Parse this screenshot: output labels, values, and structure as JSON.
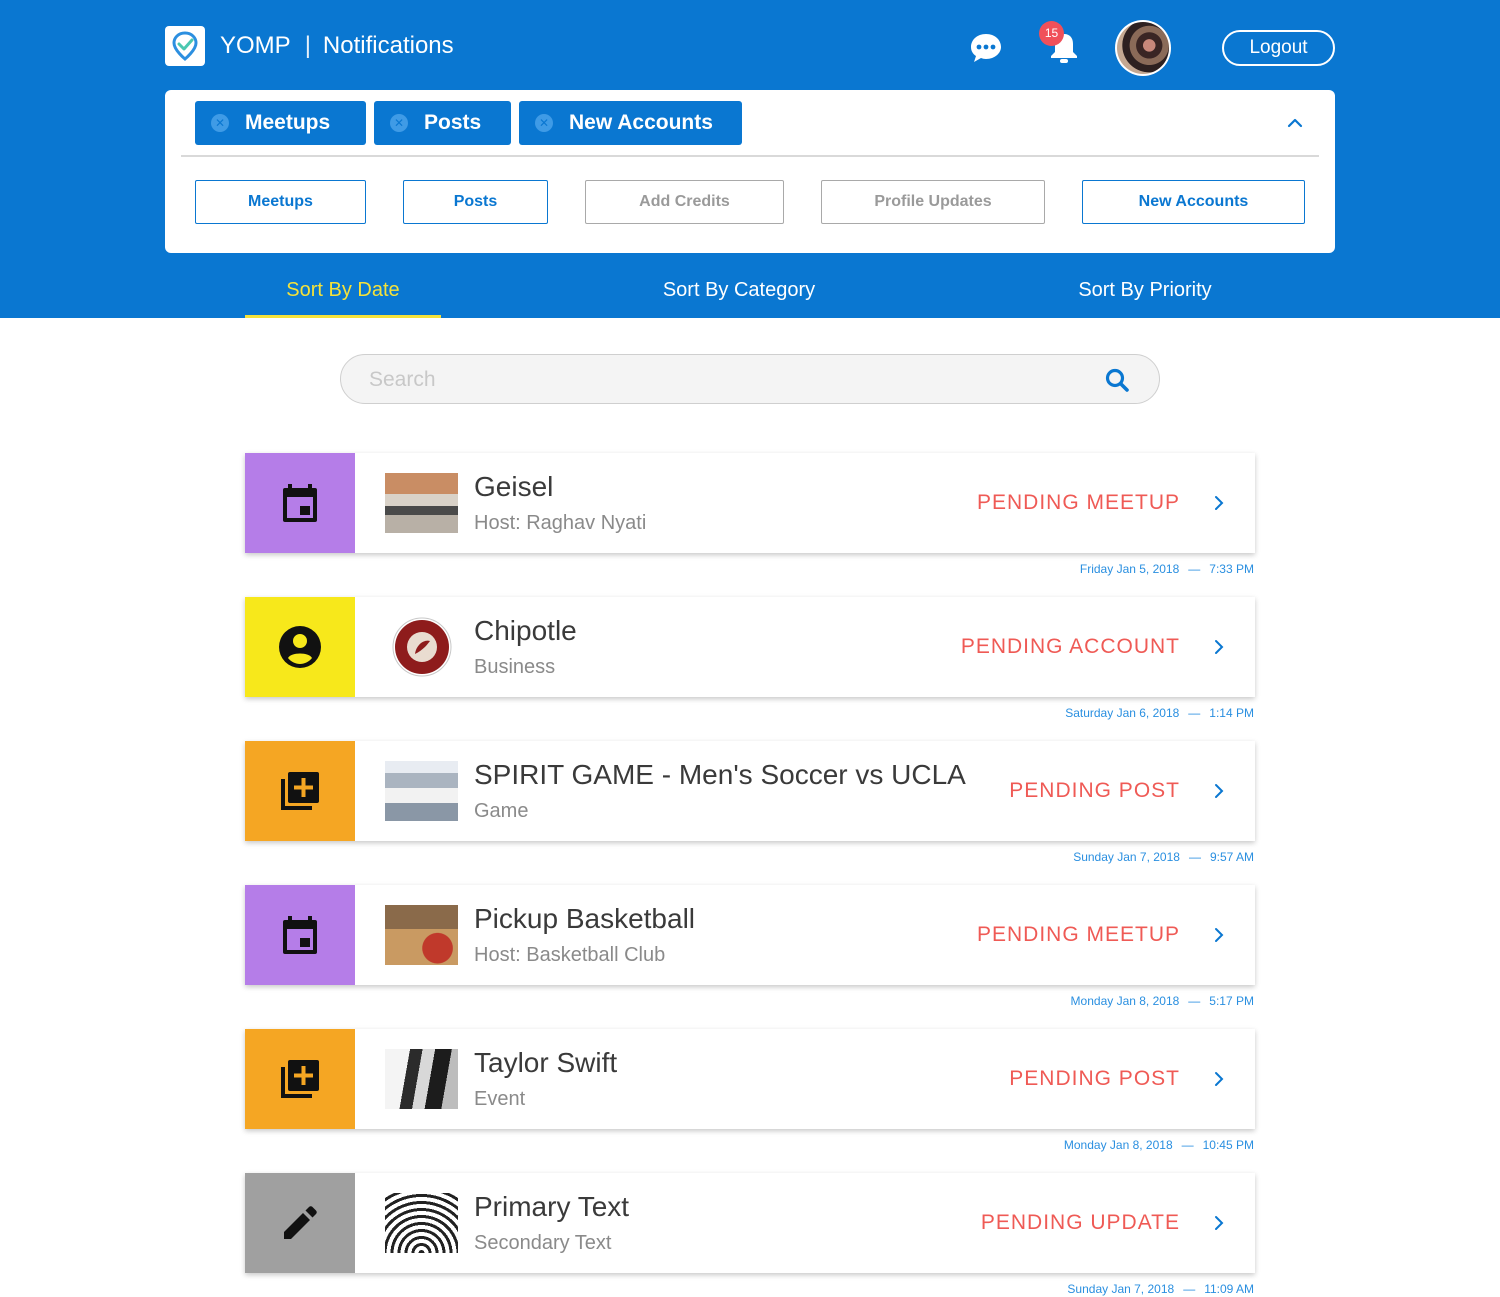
{
  "header": {
    "app_name": "YOMP",
    "page_title": "Notifications",
    "notification_count": "15",
    "logout_label": "Logout"
  },
  "active_filters": [
    {
      "label": "Meetups"
    },
    {
      "label": "Posts"
    },
    {
      "label": "New Accounts"
    }
  ],
  "filter_options": [
    {
      "label": "Meetups",
      "selected": true
    },
    {
      "label": "Posts",
      "selected": true
    },
    {
      "label": "Add Credits",
      "selected": false
    },
    {
      "label": "Profile Updates",
      "selected": false
    },
    {
      "label": "New Accounts",
      "selected": true
    }
  ],
  "sort_tabs": [
    {
      "label": "Sort By Date",
      "active": true
    },
    {
      "label": "Sort By Category",
      "active": false
    },
    {
      "label": "Sort By Priority",
      "active": false
    }
  ],
  "search": {
    "placeholder": "Search",
    "value": ""
  },
  "notifications": [
    {
      "title": "Geisel",
      "subtitle": "Host: Raghav Nyati",
      "status": "PENDING MEETUP",
      "date": "Friday Jan 5, 2018",
      "time": "7:33 PM",
      "category_icon": "calendar-icon",
      "category_color": "#b57de8"
    },
    {
      "title": "Chipotle",
      "subtitle": "Business",
      "status": "PENDING ACCOUNT",
      "date": "Saturday Jan 6, 2018",
      "time": "1:14 PM",
      "category_icon": "account-circle-icon",
      "category_color": "#f7e81b"
    },
    {
      "title": "SPIRIT GAME - Men's Soccer vs UCLA",
      "subtitle": "Game",
      "status": "PENDING POST",
      "date": "Sunday Jan 7, 2018",
      "time": "9:57 AM",
      "category_icon": "add-post-icon",
      "category_color": "#f5a623"
    },
    {
      "title": "Pickup Basketball",
      "subtitle": "Host: Basketball Club",
      "status": "PENDING MEETUP",
      "date": "Monday Jan 8, 2018",
      "time": "5:17 PM",
      "category_icon": "calendar-icon",
      "category_color": "#b57de8"
    },
    {
      "title": "Taylor Swift",
      "subtitle": "Event",
      "status": "PENDING POST",
      "date": "Monday Jan 8, 2018",
      "time": "10:45 PM",
      "category_icon": "add-post-icon",
      "category_color": "#f5a623"
    },
    {
      "title": "Primary Text",
      "subtitle": "Secondary Text",
      "status": "PENDING UPDATE",
      "date": "Sunday Jan 7, 2018",
      "time": "11:09 AM",
      "category_icon": "pencil-icon",
      "category_color": "#a0a0a0"
    }
  ],
  "colors": {
    "brand_blue": "#0a77d1",
    "active_tab": "#f5e23a",
    "status_red": "#ef5a55",
    "timestamp_blue": "#2a8fe0"
  }
}
